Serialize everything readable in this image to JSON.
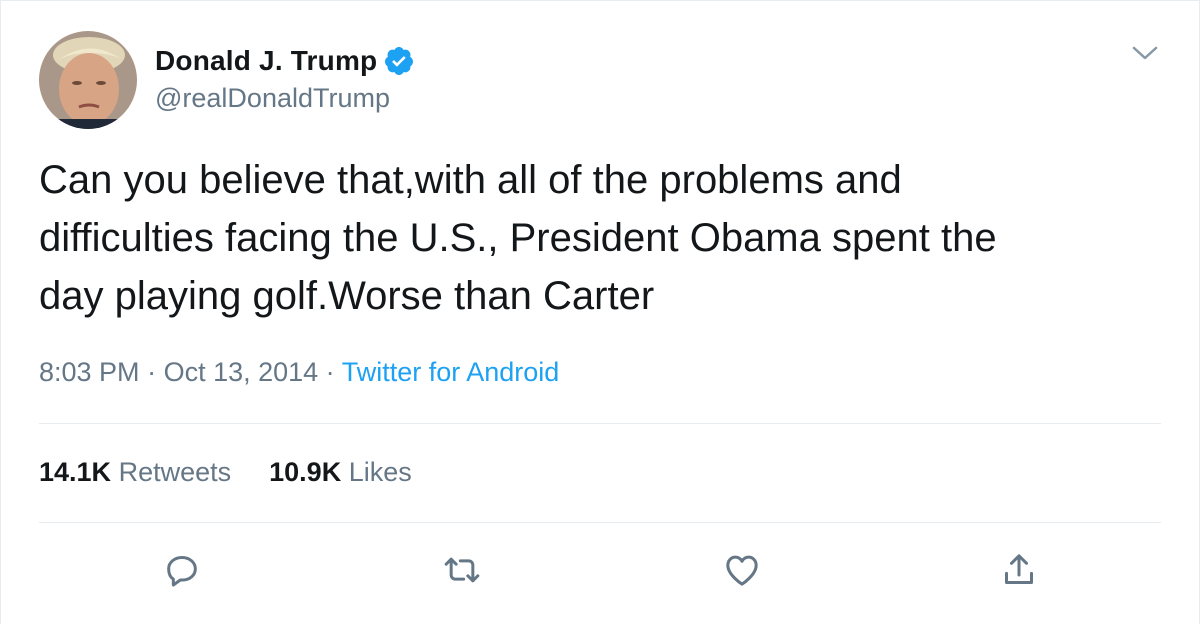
{
  "author": {
    "display_name": "Donald J. Trump",
    "handle": "@realDonaldTrump",
    "verified": true
  },
  "tweet": {
    "text": "Can you believe that,with all of the problems and\ndifficulties facing the U.S., President Obama spent the\nday playing golf.Worse than Carter",
    "time": "8:03 PM",
    "date": "Oct 13, 2014",
    "source": "Twitter for Android",
    "separator": " · "
  },
  "stats": {
    "retweets_count": "14.1K",
    "retweets_label": "Retweets",
    "likes_count": "10.9K",
    "likes_label": "Likes"
  },
  "icons": {
    "verified": "verified-badge-icon",
    "caret": "chevron-down-icon",
    "reply": "reply-icon",
    "retweet": "retweet-icon",
    "like": "heart-icon",
    "share": "share-icon"
  },
  "colors": {
    "text": "#14171a",
    "secondary": "#657786",
    "accent": "#1da1f2",
    "divider": "#e6ecf0"
  }
}
